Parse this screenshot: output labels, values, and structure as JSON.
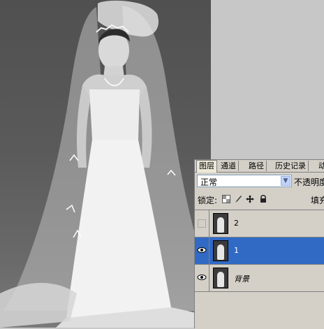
{
  "panel": {
    "tabs": [
      "图层",
      "通道",
      "路径",
      "历史记录",
      "动"
    ],
    "blend_mode": "正常",
    "opacity_label": "不透明度",
    "lock_label": "锁定:",
    "fill_label": "填充"
  },
  "layers": [
    {
      "name": "2",
      "visible": false,
      "selected": false
    },
    {
      "name": "1",
      "visible": true,
      "selected": true
    },
    {
      "name": "背景",
      "visible": true,
      "selected": false
    }
  ],
  "icons": {
    "lock_transparent": "checker-icon",
    "lock_image": "brush-icon",
    "lock_position": "move-icon",
    "lock_all": "lock-icon",
    "eye": "eye-icon",
    "dropdown": "chevron-down-icon"
  }
}
